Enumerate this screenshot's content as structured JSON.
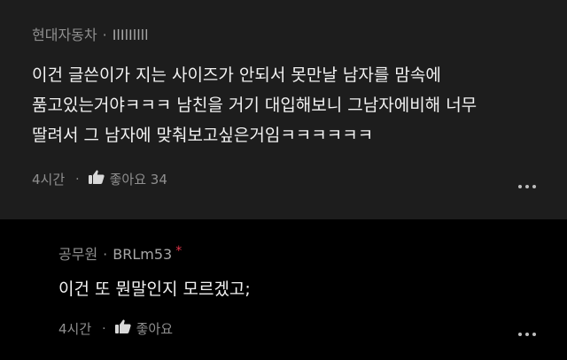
{
  "comments": [
    {
      "author": "현대자동차",
      "user_id": "IlIlIllll",
      "text": "이건 글쓴이가 지는 사이즈가 안되서 못만날 남자를 맘속에\n품고있는거야ㅋㅋㅋ 남친을 거기 대입해보니 그남자에비해 너무\n딸려서 그 남자에 맞춰보고싶은거임ㅋㅋㅋㅋㅋㅋ",
      "time": "4시간",
      "like_label": "좋아요 34",
      "more_icon": "more-horizontal-icon",
      "like_icon": "thumbs-up-icon"
    },
    {
      "author": "공무원",
      "user_id": "BRLm53",
      "badge": "*",
      "badge_color": "#e0344a",
      "text": "이건 또 뭔말인지 모르겠고;",
      "time": "4시간",
      "like_label": "좋아요",
      "more_icon": "more-horizontal-icon",
      "like_icon": "thumbs-up-icon"
    }
  ]
}
